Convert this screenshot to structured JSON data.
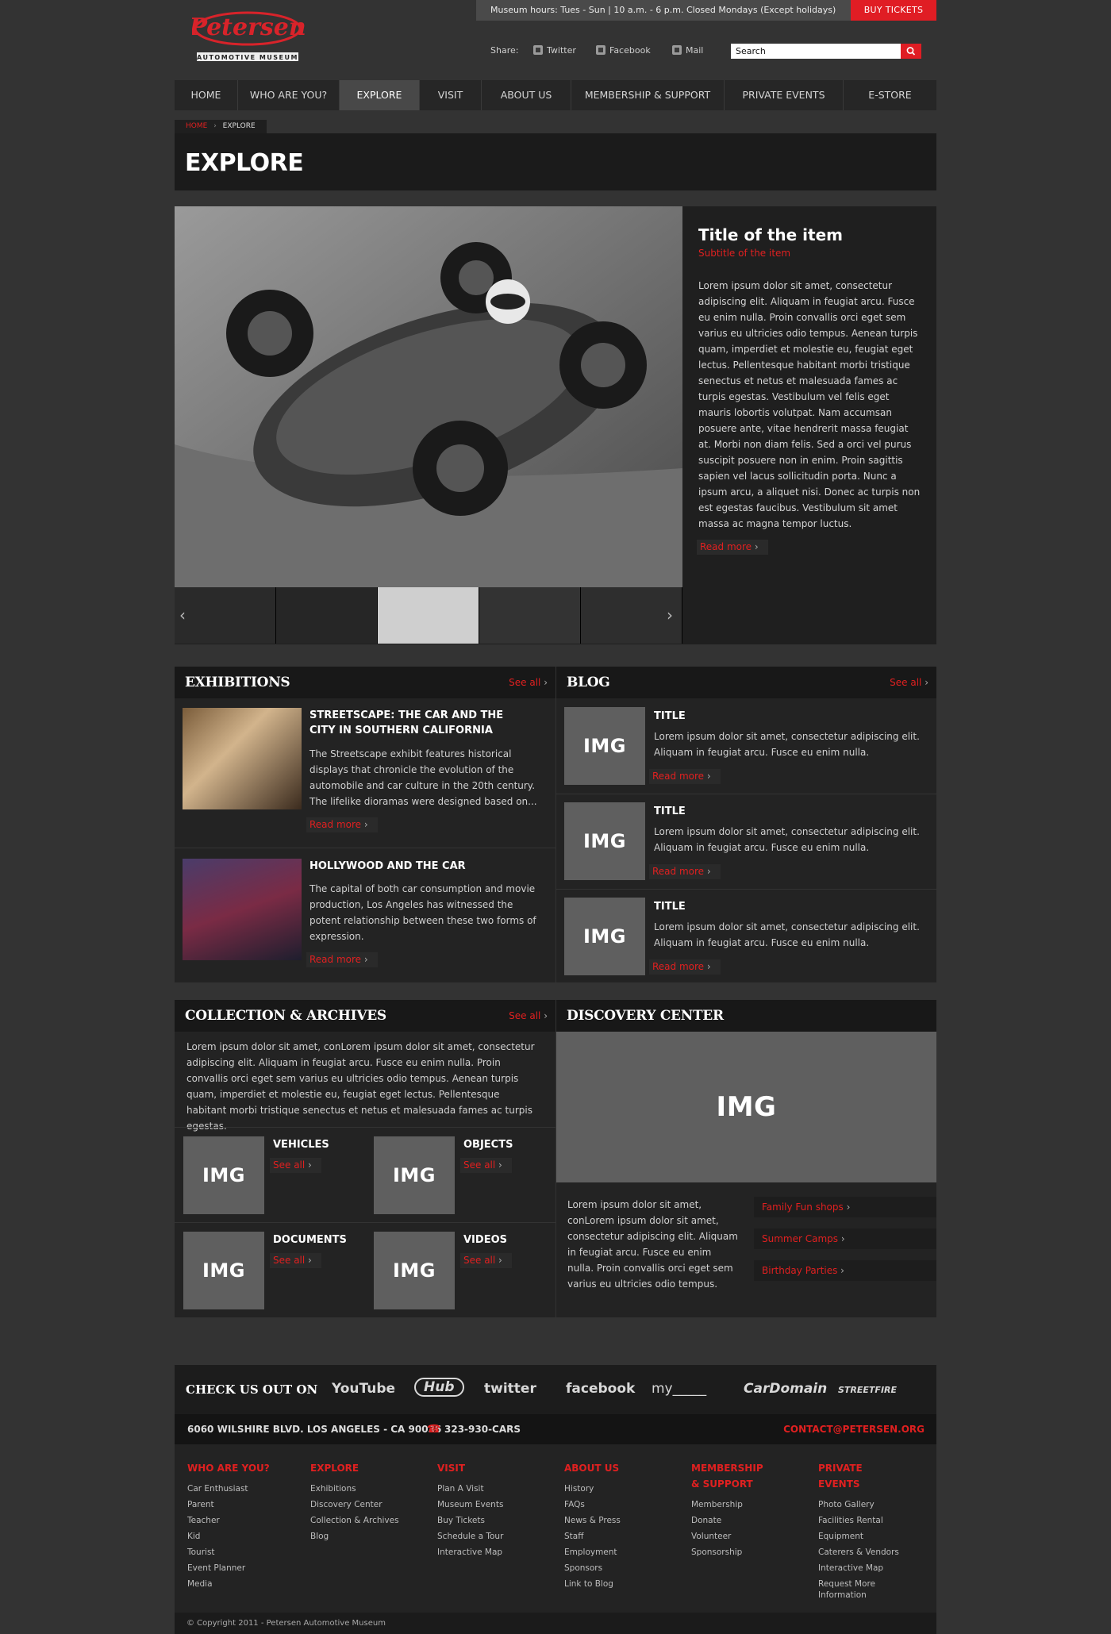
{
  "topbar": {
    "hours": "Museum hours: Tues - Sun | 10 a.m. - 6 p.m. Closed Mondays (Except holidays)",
    "buy_tickets": "BUY TICKETS"
  },
  "logo": {
    "name": "Petersen",
    "tagline": "AUTOMOTIVE MUSEUM"
  },
  "share": {
    "label": "Share:",
    "twitter": "Twitter",
    "facebook": "Facebook",
    "mail": "Mail"
  },
  "search": {
    "placeholder": "Search"
  },
  "nav": [
    "HOME",
    "WHO ARE YOU?",
    "EXPLORE",
    "VISIT",
    "ABOUT US",
    "MEMBERSHIP & SUPPORT",
    "PRIVATE EVENTS",
    "E-STORE"
  ],
  "breadcrumb": {
    "home": "HOME",
    "current": "EXPLORE"
  },
  "page_title": "EXPLORE",
  "feature": {
    "title": "Title of the item",
    "subtitle": "Subtitle of the item",
    "body": "Lorem ipsum dolor sit amet, consectetur adipiscing elit. Aliquam in feugiat arcu. Fusce eu enim nulla. Proin convallis orci eget sem varius eu ultricies odio tempus. Aenean turpis quam, imperdiet et molestie eu, feugiat eget lectus. Pellentesque habitant morbi tristique senectus et netus et malesuada fames ac turpis egestas. Vestibulum vel felis eget mauris lobortis volutpat. Nam accumsan posuere ante, vitae hendrerit massa feugiat at. Morbi non diam felis. Sed a orci vel purus suscipit posuere non in enim. Proin sagittis sapien vel lacus sollicitudin porta. Nunc a ipsum arcu, a aliquet nisi. Donec ac turpis non est egestas faucibus. Vestibulum sit amet massa ac magna tempor luctus.",
    "read_more": "Read more"
  },
  "exhibitions": {
    "heading": "EXHIBITIONS",
    "see_all": "See all",
    "items": [
      {
        "title": "STREETSCAPE: THE CAR AND THE CITY IN SOUTHERN CALIFORNIA",
        "text": "The Streetscape exhibit features historical displays that chronicle the evolution of the automobile and car culture in the 20th century. The lifelike dioramas were designed based on...",
        "read_more": "Read more"
      },
      {
        "title": "HOLLYWOOD AND THE CAR",
        "text": "The capital of both car consumption and movie production, Los Angeles has witnessed the potent relationship between these two forms of expression.",
        "read_more": "Read more"
      }
    ]
  },
  "blog": {
    "heading": "BLOG",
    "see_all": "See all",
    "items": [
      {
        "img": "IMG",
        "title": "TITLE",
        "text": "Lorem ipsum dolor sit amet, consectetur adipiscing elit. Aliquam in feugiat arcu. Fusce eu enim nulla.",
        "read_more": "Read more"
      },
      {
        "img": "IMG",
        "title": "TITLE",
        "text": "Lorem ipsum dolor sit amet, consectetur adipiscing elit. Aliquam in feugiat arcu. Fusce eu enim nulla.",
        "read_more": "Read more"
      },
      {
        "img": "IMG",
        "title": "TITLE",
        "text": "Lorem ipsum dolor sit amet, consectetur adipiscing elit. Aliquam in feugiat arcu. Fusce eu enim nulla.",
        "read_more": "Read more"
      }
    ]
  },
  "collection": {
    "heading": "COLLECTION & ARCHIVES",
    "see_all": "See all",
    "intro": "Lorem ipsum dolor sit amet, conLorem ipsum dolor sit amet, consectetur adipiscing elit. Aliquam in feugiat arcu. Fusce eu enim nulla. Proin convallis orci eget sem varius eu ultricies odio tempus. Aenean turpis quam, imperdiet et molestie eu, feugiat eget lectus. Pellentesque habitant morbi tristique senectus et netus et malesuada fames ac turpis egestas.",
    "items": [
      {
        "img": "IMG",
        "title": "VEHICLES",
        "see_all": "See all"
      },
      {
        "img": "IMG",
        "title": "OBJECTS",
        "see_all": "See all"
      },
      {
        "img": "IMG",
        "title": "DOCUMENTS",
        "see_all": "See all"
      },
      {
        "img": "IMG",
        "title": "VIDEOS",
        "see_all": "See all"
      }
    ]
  },
  "discovery": {
    "heading": "DISCOVERY CENTER",
    "img": "IMG",
    "text": "Lorem ipsum dolor sit amet, conLorem ipsum dolor sit amet, consectetur adipiscing elit. Aliquam in feugiat arcu. Fusce eu enim nulla. Proin convallis orci eget sem varius eu ultricies odio tempus.",
    "links": [
      "Family Fun shops",
      "Summer Camps",
      "Birthday Parties"
    ]
  },
  "social": {
    "label": "CHECK US OUT ON",
    "sites": [
      "YouTube",
      "Hub",
      "twitter",
      "facebook",
      "my_____",
      "CarDomain",
      "STREETFIRE"
    ]
  },
  "address": {
    "line": "6060 WILSHIRE BLVD. LOS ANGELES - CA 90036",
    "phone": "323-930-CARS",
    "email": "CONTACT@PETERSEN.ORG"
  },
  "footer": {
    "columns": [
      {
        "heading": "WHO ARE YOU?",
        "links": [
          "Car Enthusiast",
          "Parent",
          "Teacher",
          "Kid",
          "Tourist",
          "Event Planner",
          "Media"
        ]
      },
      {
        "heading": "EXPLORE",
        "links": [
          "Exhibitions",
          "Discovery Center",
          "Collection & Archives",
          "Blog"
        ]
      },
      {
        "heading": "VISIT",
        "links": [
          "Plan A Visit",
          "Museum Events",
          "Buy Tickets",
          "Schedule a Tour",
          "Interactive Map"
        ]
      },
      {
        "heading": "ABOUT US",
        "links": [
          "History",
          "FAQs",
          "News & Press",
          "Staff",
          "Employment",
          "Sponsors",
          "Link to Blog"
        ]
      },
      {
        "heading": "MEMBERSHIP & SUPPORT",
        "links": [
          "Membership",
          "Donate",
          "Volunteer",
          "Sponsorship"
        ]
      },
      {
        "heading": "PRIVATE EVENTS",
        "links": [
          "Photo Gallery",
          "Facilities Rental",
          "Equipment",
          "Caterers & Vendors",
          "Interactive Map",
          "Request More Information"
        ]
      }
    ],
    "copyright": "© Copyright 2011 - Petersen Automotive Museum"
  },
  "colors": {
    "accent": "#e01d24",
    "page_bg": "#333333",
    "panel_bg": "#232323",
    "header_bg": "#181818"
  }
}
